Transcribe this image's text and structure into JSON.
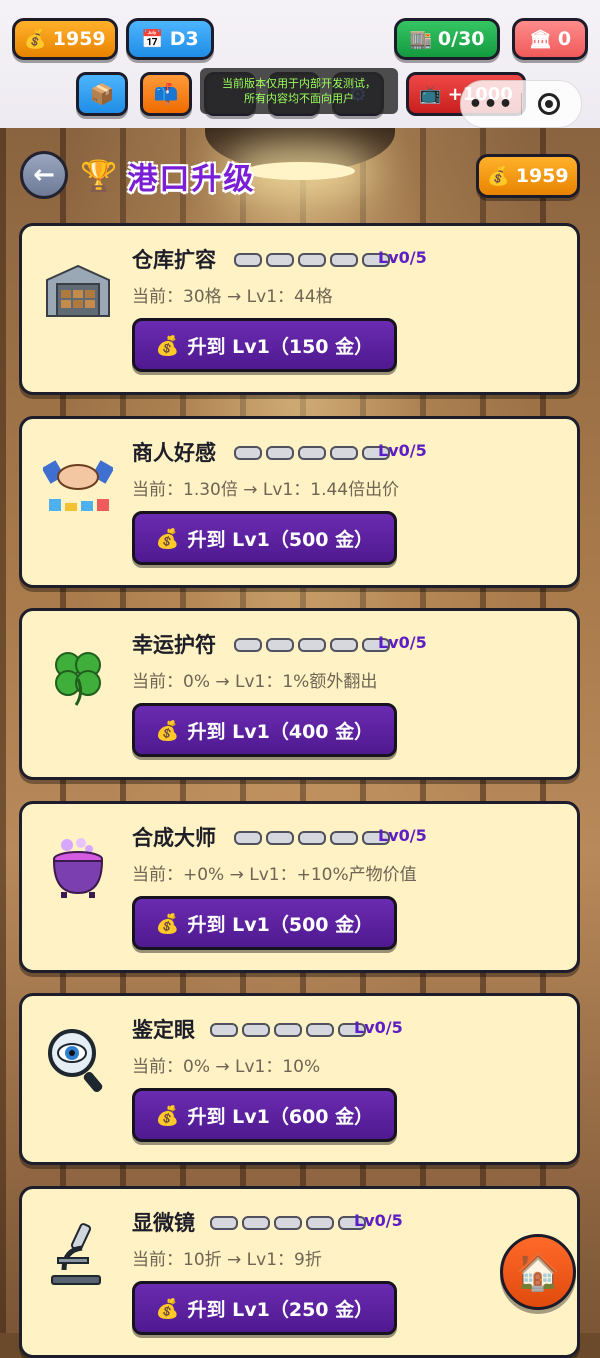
{
  "status_bar": {
    "coins": "1959",
    "day": "D3",
    "inventory": "0/30",
    "bank": "0"
  },
  "quick_buttons": {
    "reward_label": "+1000"
  },
  "notice": {
    "line1": "当前版本仅用于内部开发测试，",
    "line2": "所有内容均不面向用户"
  },
  "header": {
    "title": "港口升级",
    "coins": "1959"
  },
  "upgrades": [
    {
      "name": "仓库扩容",
      "level": "Lv0/5",
      "current": "当前：30格 → Lv1：44格",
      "button": "升到 Lv1（150 金）",
      "icon": "warehouse-icon"
    },
    {
      "name": "商人好感",
      "level": "Lv0/5",
      "current": "当前：1.30倍 → Lv1：1.44倍出价",
      "button": "升到 Lv1（500 金）",
      "icon": "handshake-icon"
    },
    {
      "name": "幸运护符",
      "level": "Lv0/5",
      "current": "当前：0% → Lv1：1%额外翻出",
      "button": "升到 Lv1（400 金）",
      "icon": "clover-icon"
    },
    {
      "name": "合成大师",
      "level": "Lv0/5",
      "current": "当前：+0% → Lv1：+10%产物价值",
      "button": "升到 Lv1（500 金）",
      "icon": "cauldron-icon"
    },
    {
      "name": "鉴定眼",
      "level": "Lv0/5",
      "current": "当前：0% → Lv1：10%",
      "button": "升到 Lv1（600 金）",
      "icon": "magnifier-eye-icon"
    },
    {
      "name": "显微镜",
      "level": "Lv0/5",
      "current": "当前：10折 → Lv1：9折",
      "button": "升到 Lv1（250 金）",
      "icon": "microscope-icon"
    }
  ],
  "colors": {
    "accent_purple": "#5d1ec4",
    "button_purple": "#5a1fa0",
    "card_bg": "#fff2c4",
    "gold": "#f59a12"
  }
}
